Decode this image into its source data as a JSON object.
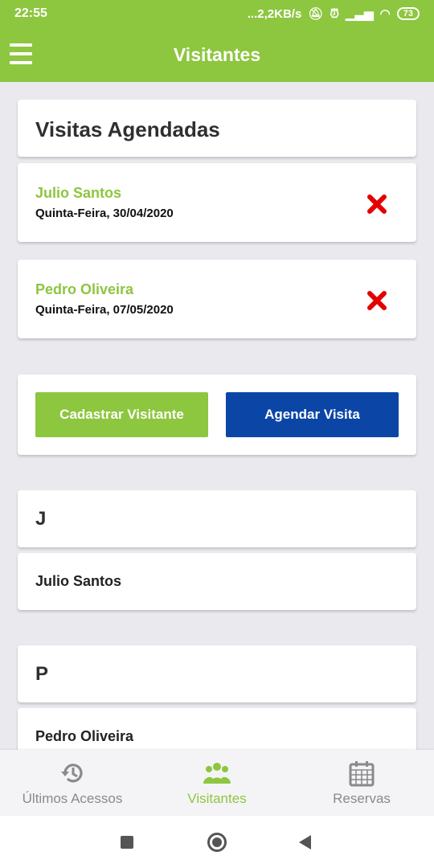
{
  "status": {
    "time": "22:55",
    "speed": "...2,2KB/s",
    "battery": "73"
  },
  "app": {
    "title": "Visitantes"
  },
  "scheduled": {
    "title": "Visitas Agendadas",
    "visits": [
      {
        "name": "Julio Santos",
        "date": "Quinta-Feira, 30/04/2020"
      },
      {
        "name": "Pedro Oliveira",
        "date": "Quinta-Feira, 07/05/2020"
      }
    ]
  },
  "actions": {
    "register_label": "Cadastrar Visitante",
    "schedule_label": "Agendar Visita"
  },
  "contacts": {
    "groups": [
      {
        "letter": "J",
        "names": [
          "Julio Santos"
        ]
      },
      {
        "letter": "P",
        "names": [
          "Pedro Oliveira"
        ]
      }
    ]
  },
  "bottom_nav": {
    "items": [
      {
        "label": "Últimos Acessos",
        "icon": "history-icon"
      },
      {
        "label": "Visitantes",
        "icon": "group-icon",
        "active": true
      },
      {
        "label": "Reservas",
        "icon": "calendar-icon"
      }
    ]
  },
  "colors": {
    "accent": "#8dc63f",
    "primary": "#0b46a6",
    "danger": "#e30000"
  }
}
